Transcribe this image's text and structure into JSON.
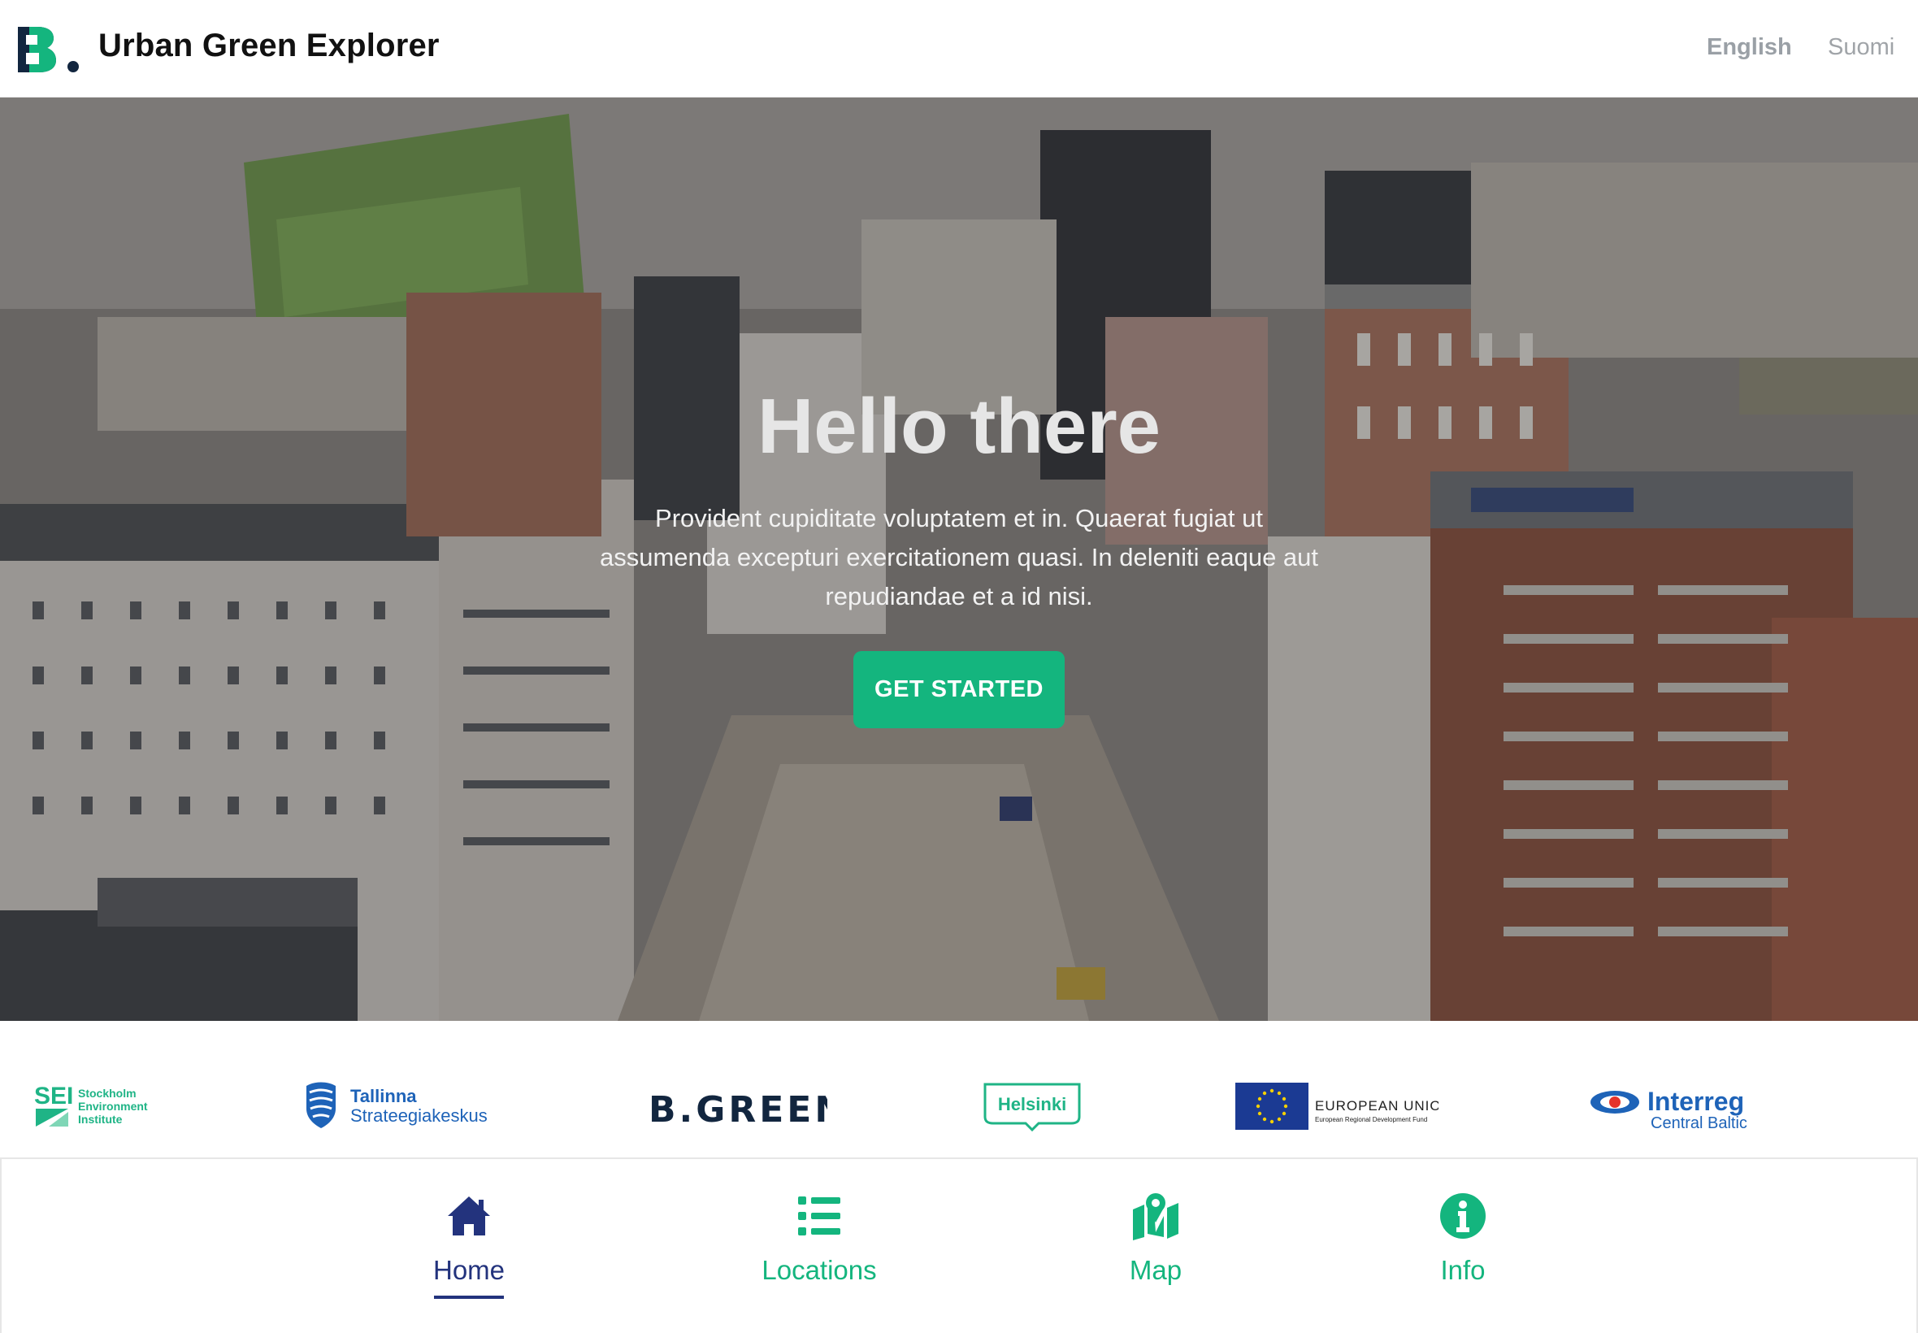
{
  "header": {
    "app_title": "Urban Green Explorer",
    "languages": [
      {
        "label": "English",
        "active": true
      },
      {
        "label": "Suomi",
        "active": false
      }
    ]
  },
  "hero": {
    "title": "Hello there",
    "subtitle": "Provident cupiditate voluptatem et in. Quaerat fugiat ut assumenda excepturi exercitationem quasi. In deleniti eaque aut repudiandae et a id nisi.",
    "cta_label": "GET STARTED"
  },
  "partners": {
    "sei": {
      "mark": "SEI",
      "line1": "Stockholm",
      "line2": "Environment",
      "line3": "Institute"
    },
    "tallinna": {
      "line1": "Tallinna",
      "line2": "Strateegiakeskus"
    },
    "bgreen": {
      "text": "B.GREEN"
    },
    "helsinki": {
      "text": "Helsinki"
    },
    "eu": {
      "line1": "EUROPEAN UNION",
      "line2": "European Regional Development Fund"
    },
    "interreg": {
      "line1": "Interreg",
      "line2": "Central Baltic"
    }
  },
  "nav": {
    "items": [
      {
        "label": "Home",
        "icon": "home-icon",
        "active": true
      },
      {
        "label": "Locations",
        "icon": "list-icon",
        "active": false
      },
      {
        "label": "Map",
        "icon": "map-icon",
        "active": false
      },
      {
        "label": "Info",
        "icon": "info-icon",
        "active": false
      }
    ]
  },
  "colors": {
    "accent": "#14b57e",
    "nav_active": "#23337d",
    "brand_dark": "#12263f"
  }
}
